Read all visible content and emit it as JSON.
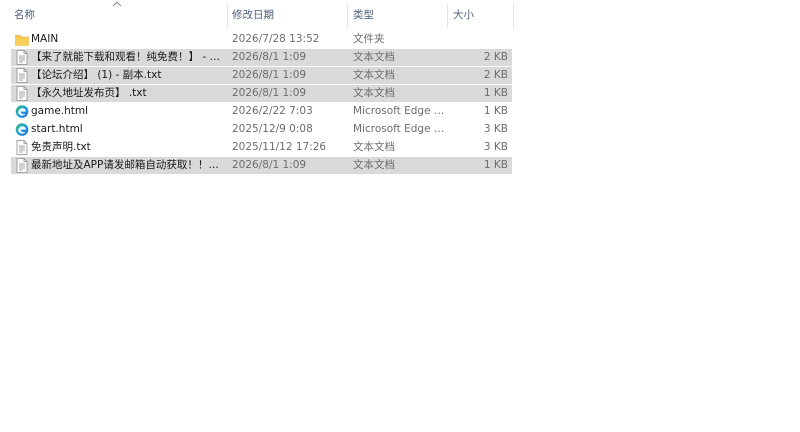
{
  "columns": {
    "name": "名称",
    "date": "修改日期",
    "type": "类型",
    "size": "大小"
  },
  "files": [
    {
      "icon": "folder-icon",
      "name": "MAIN",
      "date": "2026/7/28 13:52",
      "type": "文件夹",
      "size": "",
      "selected": false
    },
    {
      "icon": "text-file-icon",
      "name": "【来了就能下载和观看！纯免费！】 - 副本.txt",
      "date": "2026/8/1 1:09",
      "type": "文本文档",
      "size": "2 KB",
      "selected": true
    },
    {
      "icon": "text-file-icon",
      "name": "【论坛介绍】 (1) - 副本.txt",
      "date": "2026/8/1 1:09",
      "type": "文本文档",
      "size": "2 KB",
      "selected": true
    },
    {
      "icon": "text-file-icon",
      "name": "【永久地址发布页】 .txt",
      "date": "2026/8/1 1:09",
      "type": "文本文档",
      "size": "1 KB",
      "selected": true
    },
    {
      "icon": "edge-icon",
      "name": "game.html",
      "date": "2026/2/22 7:03",
      "type": "Microsoft Edge HTML Document",
      "size": "1 KB",
      "selected": false
    },
    {
      "icon": "edge-icon",
      "name": "start.html",
      "date": "2025/12/9 0:08",
      "type": "Microsoft Edge HTML Document",
      "size": "3 KB",
      "selected": false
    },
    {
      "icon": "text-file-icon",
      "name": "免责声明.txt",
      "date": "2025/11/12 17:26",
      "type": "文本文档",
      "size": "3 KB",
      "selected": false
    },
    {
      "icon": "text-file-icon",
      "name": "最新地址及APP请发邮箱自动获取！！！.txt",
      "date": "2026/8/1 1:09",
      "type": "文本文档",
      "size": "1 KB",
      "selected": true
    }
  ],
  "colors": {
    "selected_row": "#d9d9d9",
    "header_text": "#4c607a",
    "folder": "#f5c342",
    "edge_blue": "#1b7fd6",
    "edge_green": "#3fc46a"
  }
}
